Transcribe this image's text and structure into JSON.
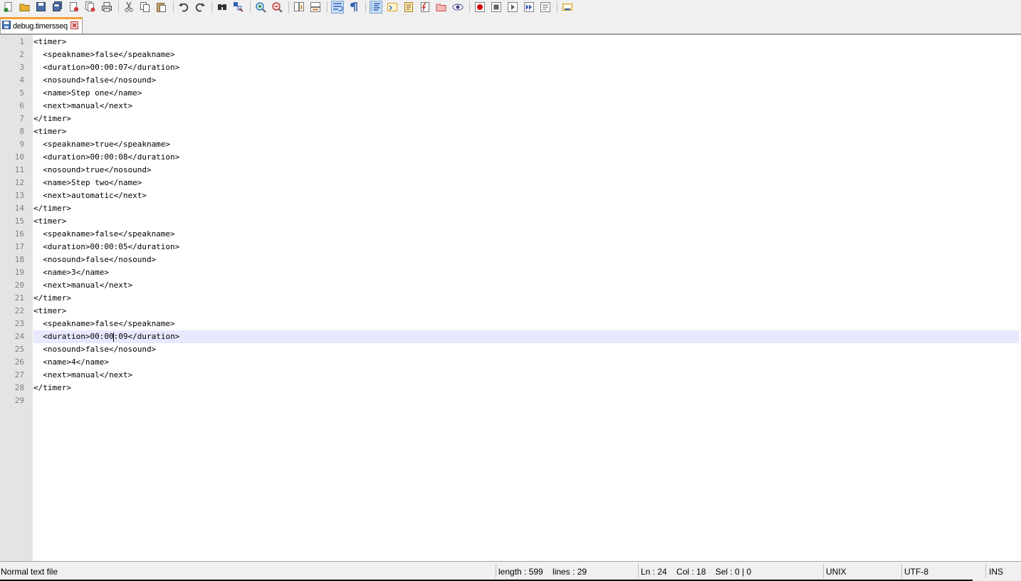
{
  "toolbar": {
    "buttons": [
      {
        "icon": "new-file-icon",
        "color": "#2e8b2e"
      },
      {
        "icon": "open-file-icon",
        "color": "#e8b030"
      },
      {
        "icon": "save-icon",
        "color": "#4a6fa5"
      },
      {
        "icon": "save-all-icon",
        "color": "#4a6fa5"
      },
      {
        "icon": "close-icon",
        "color": "#d04040"
      },
      {
        "icon": "close-all-icon",
        "color": "#d04040"
      },
      {
        "icon": "print-icon",
        "color": "#606060"
      },
      {
        "sep": true
      },
      {
        "icon": "cut-icon",
        "color": "#606060"
      },
      {
        "icon": "copy-icon",
        "color": "#606060"
      },
      {
        "icon": "paste-icon",
        "color": "#806040"
      },
      {
        "sep": true
      },
      {
        "icon": "undo-icon",
        "color": "#404040"
      },
      {
        "icon": "redo-icon",
        "color": "#404040"
      },
      {
        "sep": true
      },
      {
        "icon": "find-icon",
        "color": "#303030"
      },
      {
        "icon": "replace-icon",
        "color": "#3060b0"
      },
      {
        "sep": true
      },
      {
        "icon": "zoom-in-icon",
        "color": "#3080c0"
      },
      {
        "icon": "zoom-out-icon",
        "color": "#c04040"
      },
      {
        "sep": true
      },
      {
        "icon": "sync-vertical-icon",
        "color": "#d08030"
      },
      {
        "icon": "sync-horizontal-icon",
        "color": "#d08030"
      },
      {
        "sep": true
      },
      {
        "icon": "word-wrap-icon",
        "color": "#3060b0",
        "active": true
      },
      {
        "icon": "show-all-chars-icon",
        "color": "#3060b0"
      },
      {
        "sep": true
      },
      {
        "icon": "indent-guide-icon",
        "color": "#3060b0",
        "active": true
      },
      {
        "icon": "user-language-icon",
        "color": "#e0a020"
      },
      {
        "icon": "doc-map-icon",
        "color": "#b08020"
      },
      {
        "icon": "function-list-icon",
        "color": "#c03030"
      },
      {
        "icon": "folder-workspace-icon",
        "color": "#d05050"
      },
      {
        "icon": "monitoring-icon",
        "color": "#404080"
      },
      {
        "sep": true
      },
      {
        "icon": "record-macro-icon",
        "color": "#d00000"
      },
      {
        "icon": "stop-record-icon",
        "color": "#606060"
      },
      {
        "icon": "play-macro-icon",
        "color": "#606060"
      },
      {
        "icon": "run-macro-multiple-icon",
        "color": "#3060b0"
      },
      {
        "icon": "save-macro-icon",
        "color": "#606060"
      },
      {
        "sep": true
      },
      {
        "icon": "launch-browser-icon",
        "color": "#d0a020"
      }
    ]
  },
  "tab": {
    "label": "debug.timersseq"
  },
  "editor": {
    "current_line": 24,
    "lines": [
      "<timer>",
      "  <speakname>false</speakname>",
      "  <duration>00:00:07</duration>",
      "  <nosound>false</nosound>",
      "  <name>Step one</name>",
      "  <next>manual</next>",
      "</timer>",
      "<timer>",
      "  <speakname>true</speakname>",
      "  <duration>00:00:08</duration>",
      "  <nosound>true</nosound>",
      "  <name>Step two</name>",
      "  <next>automatic</next>",
      "</timer>",
      "<timer>",
      "  <speakname>false</speakname>",
      "  <duration>00:00:05</duration>",
      "  <nosound>false</nosound>",
      "  <name>3</name>",
      "  <next>manual</next>",
      "</timer>",
      "<timer>",
      "  <speakname>false</speakname>",
      "  <duration>00:00:09</duration>",
      "  <nosound>false</nosound>",
      "  <name>4</name>",
      "  <next>manual</next>",
      "</timer>",
      ""
    ]
  },
  "statusbar": {
    "file_type": "Normal text file",
    "length_lines": "length : 599    lines : 29",
    "position": "Ln : 24    Col : 18    Sel : 0 | 0",
    "eol": "UNIX",
    "encoding": "UTF-8",
    "mode": "INS"
  }
}
